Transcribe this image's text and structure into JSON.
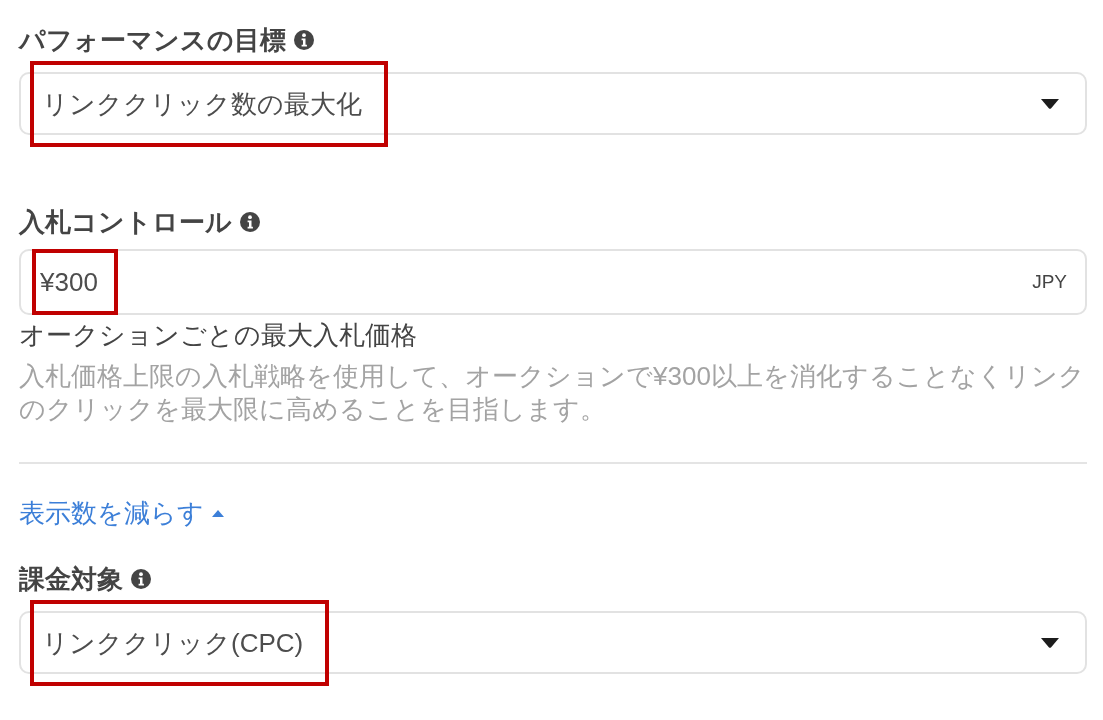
{
  "blocks": [
    {
      "kind": "select",
      "label": "パフォーマンスの目標",
      "value": "リンククリック数の最大化",
      "highlighted": true
    },
    {
      "kind": "amount",
      "label": "入札コントロール",
      "value": "¥300",
      "suffix": "JPY",
      "highlighted": true,
      "caption": "オークションごとの最大入札価格",
      "help": "入札価格上限の入札戦略を使用して、オークションで¥300以上を消化することなくリンクのクリックを最大限に高めることを目指します。"
    },
    {
      "kind": "toggle",
      "label": "表示数を減らす",
      "expanded": true
    },
    {
      "kind": "select",
      "label": "課金対象",
      "value": "リンククリック(CPC)",
      "highlighted": true
    }
  ]
}
